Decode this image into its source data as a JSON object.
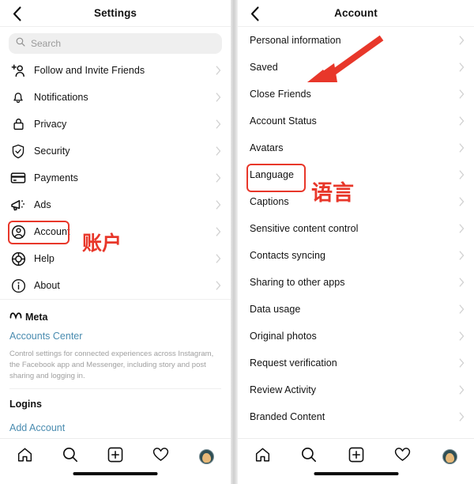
{
  "colors": {
    "accent_red": "#e8372a",
    "link_blue": "#4a8cb0",
    "text_primary": "#121212",
    "text_muted": "#a0a0a0",
    "chevron": "#cfcfcf",
    "search_bg": "#efefef",
    "avatar_ring": "#2f4f55"
  },
  "left_screen": {
    "header": {
      "title": "Settings",
      "back_icon": "chevron-left-icon"
    },
    "search": {
      "placeholder": "Search",
      "icon": "search-icon",
      "value": ""
    },
    "items": [
      {
        "label": "Follow and Invite Friends",
        "icon": "person-add-icon"
      },
      {
        "label": "Notifications",
        "icon": "bell-icon"
      },
      {
        "label": "Privacy",
        "icon": "lock-icon"
      },
      {
        "label": "Security",
        "icon": "shield-check-icon"
      },
      {
        "label": "Payments",
        "icon": "credit-card-icon"
      },
      {
        "label": "Ads",
        "icon": "megaphone-icon"
      },
      {
        "label": "Account",
        "icon": "account-circle-icon"
      },
      {
        "label": "Help",
        "icon": "lifebuoy-icon"
      },
      {
        "label": "About",
        "icon": "info-circle-icon"
      }
    ],
    "meta": {
      "brand": "Meta",
      "brand_icon": "meta-infinity-icon",
      "link": "Accounts Center",
      "description": "Control settings for connected experiences across Instagram, the Facebook app and Messenger, including story and post sharing and logging in."
    },
    "logins": {
      "heading": "Logins",
      "add_account": "Add Account"
    },
    "annotation": {
      "highlight_target": "Account",
      "note": "账户"
    }
  },
  "right_screen": {
    "header": {
      "title": "Account",
      "back_icon": "chevron-left-icon"
    },
    "items": [
      {
        "label": "Personal information"
      },
      {
        "label": "Saved"
      },
      {
        "label": "Close Friends"
      },
      {
        "label": "Account Status"
      },
      {
        "label": "Avatars"
      },
      {
        "label": "Language"
      },
      {
        "label": "Captions"
      },
      {
        "label": "Sensitive content control"
      },
      {
        "label": "Contacts syncing"
      },
      {
        "label": "Sharing to other apps"
      },
      {
        "label": "Data usage"
      },
      {
        "label": "Original photos"
      },
      {
        "label": "Request verification"
      },
      {
        "label": "Review Activity"
      },
      {
        "label": "Branded Content"
      }
    ],
    "annotation": {
      "highlight_target": "Language",
      "note": "语言",
      "arrow": "red-arrow-pointing-down-left"
    }
  },
  "tabbar": {
    "items": [
      {
        "name": "home",
        "icon": "home-icon"
      },
      {
        "name": "search",
        "icon": "search-icon"
      },
      {
        "name": "create",
        "icon": "plus-square-icon"
      },
      {
        "name": "activity",
        "icon": "heart-icon"
      },
      {
        "name": "profile",
        "icon": "avatar-icon"
      }
    ]
  }
}
